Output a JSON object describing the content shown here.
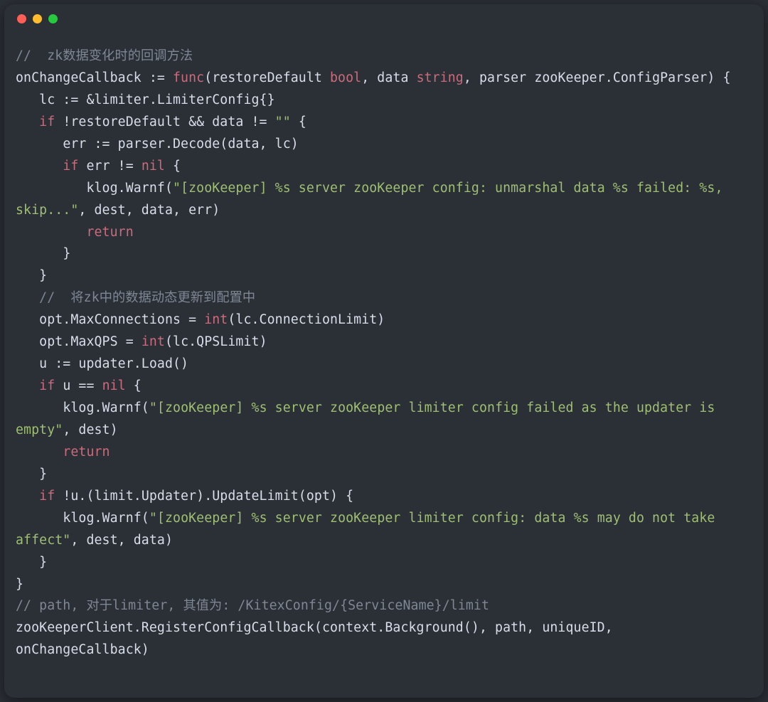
{
  "window": {
    "traffic_lights": [
      "close",
      "minimize",
      "zoom"
    ]
  },
  "code": {
    "comment1": "//  zk数据变化时的回调方法",
    "l1_a": "onChangeCallback := ",
    "l1_func": "func",
    "l1_b": "(restoreDefault ",
    "l1_bool": "bool",
    "l1_c": ", data ",
    "l1_string": "string",
    "l1_d": ", parser zooKeeper.ConfigParser) {",
    "l2": "   lc := &limiter.LimiterConfig{}",
    "l3_a": "   ",
    "l3_if": "if",
    "l3_b": " !restoreDefault && data != ",
    "l3_empty": "\"\"",
    "l3_c": " {",
    "l4": "      err := parser.Decode(data, lc)",
    "l5_a": "      ",
    "l5_if": "if",
    "l5_b": " err != ",
    "l5_nil": "nil",
    "l5_c": " {",
    "l6_a": "         klog.Warnf(",
    "l6_str": "\"[zooKeeper] %s server zooKeeper config: unmarshal data %s failed: %s, skip...\"",
    "l6_b": ", dest, data, err)",
    "l7_a": "         ",
    "l7_return": "return",
    "l8": "      }",
    "l9": "   }",
    "comment2": "   //  将zk中的数据动态更新到配置中",
    "l10_a": "   opt.MaxConnections = ",
    "l10_int": "int",
    "l10_b": "(lc.ConnectionLimit)",
    "l11_a": "   opt.MaxQPS = ",
    "l11_int": "int",
    "l11_b": "(lc.QPSLimit)",
    "l12": "   u := updater.Load()",
    "l13_a": "   ",
    "l13_if": "if",
    "l13_b": " u == ",
    "l13_nil": "nil",
    "l13_c": " {",
    "l14_a": "      klog.Warnf(",
    "l14_str": "\"[zooKeeper] %s server zooKeeper limiter config failed as the updater is empty\"",
    "l14_b": ", dest)",
    "l15_a": "      ",
    "l15_return": "return",
    "l16": "   }",
    "l17_a": "   ",
    "l17_if": "if",
    "l17_b": " !u.(limit.Updater).UpdateLimit(opt) {",
    "l18_a": "      klog.Warnf(",
    "l18_str": "\"[zooKeeper] %s server zooKeeper limiter config: data %s may do not take affect\"",
    "l18_b": ", dest, data)",
    "l19": "   }",
    "l20": "}",
    "comment3": "// path, 对于limiter, 其值为: /KitexConfig/{ServiceName}/limit",
    "l21": "zooKeeperClient.RegisterConfigCallback(context.Background(), path, uniqueID, onChangeCallback)"
  }
}
